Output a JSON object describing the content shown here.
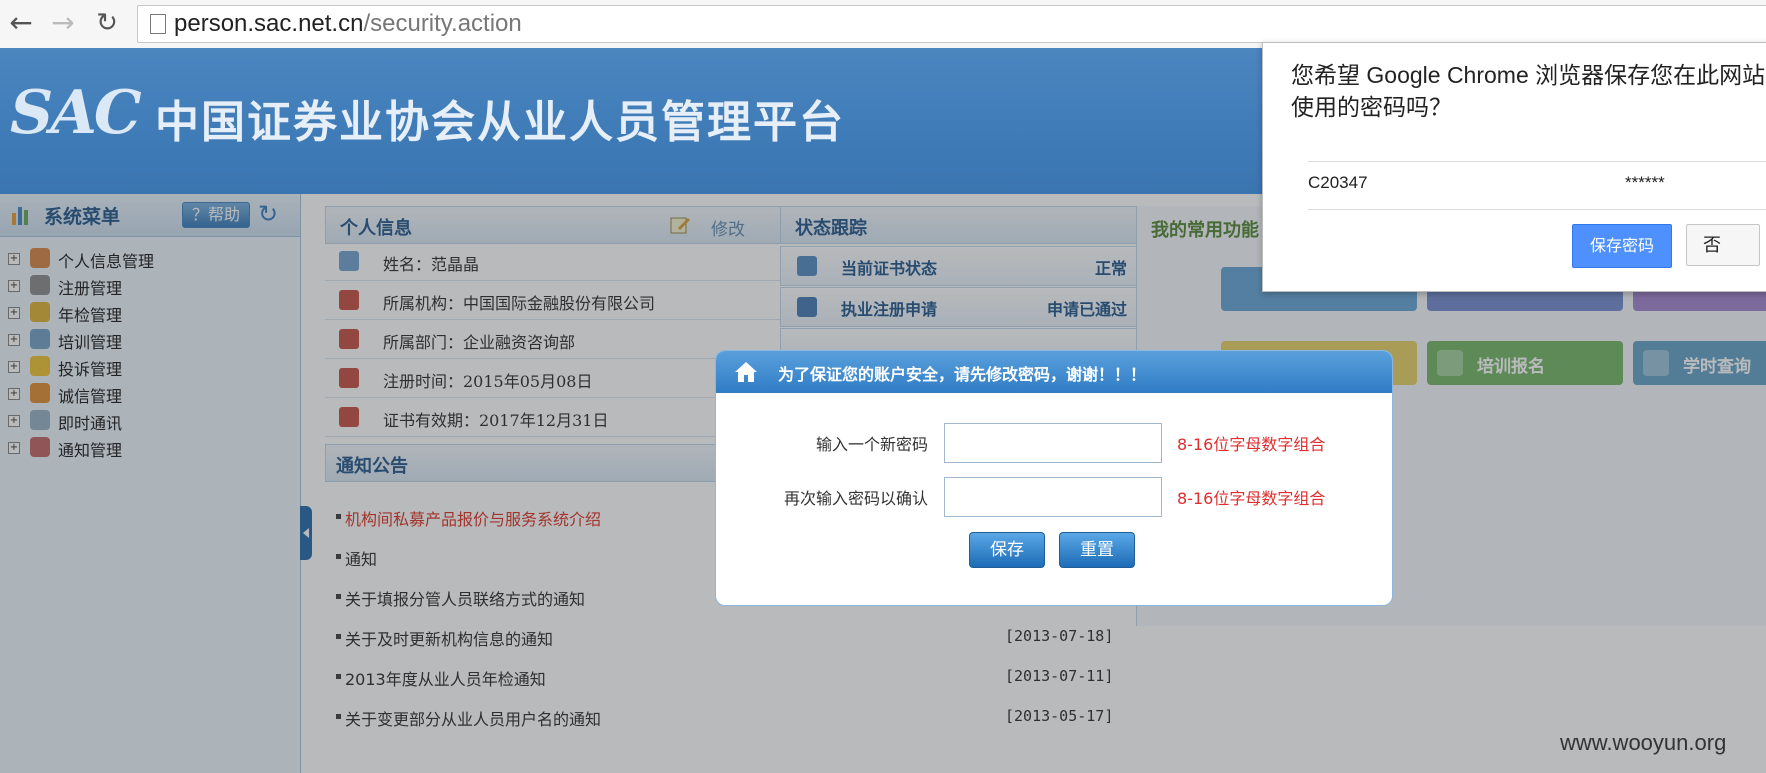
{
  "browser": {
    "url_host": "person.sac.net.cn",
    "url_path": "/security.action",
    "icons": {
      "back": "back-arrow-icon",
      "forward": "forward-arrow-icon",
      "reload": "reload-icon",
      "page": "page-icon"
    }
  },
  "site": {
    "logo_text": "SAC",
    "title": "中国证券业协会从业人员管理平台"
  },
  "sidebar": {
    "title": "系统菜单",
    "help_label": "？帮助",
    "items": [
      {
        "label": "个人信息管理",
        "color": "#d98a4a"
      },
      {
        "label": "注册管理",
        "color": "#8f8f8f"
      },
      {
        "label": "年检管理",
        "color": "#e0b53a"
      },
      {
        "label": "培训管理",
        "color": "#7aa6c9"
      },
      {
        "label": "投诉管理",
        "color": "#f0c53a"
      },
      {
        "label": "诚信管理",
        "color": "#e4923a"
      },
      {
        "label": "即时通讯",
        "color": "#9ab4c8"
      },
      {
        "label": "通知管理",
        "color": "#c46b6b"
      }
    ]
  },
  "personal_info": {
    "title": "个人信息",
    "edit_label": "修改",
    "rows": [
      "姓名：范晶晶",
      "所属机构：中国国际金融股份有限公司",
      "所属部门：企业融资咨询部",
      "注册时间：2015年05月08日",
      "证书有效期：2017年12月31日"
    ]
  },
  "status_tracking": {
    "title": "状态跟踪",
    "rows": [
      {
        "label": "当前证书状态",
        "value": "正常"
      },
      {
        "label": "执业注册申请",
        "value": "申请已通过"
      }
    ]
  },
  "notices": {
    "title": "通知公告",
    "items": [
      {
        "text": "机构间私募产品报价与服务系统介绍",
        "date": ""
      },
      {
        "text": "通知",
        "date": ""
      },
      {
        "text": "关于填报分管人员联络方式的通知",
        "date": ""
      },
      {
        "text": "关于及时更新机构信息的通知",
        "date": "[2013-07-18]"
      },
      {
        "text": "2013年度从业人员年检通知",
        "date": "[2013-07-11]"
      },
      {
        "text": "关于变更部分从业人员用户名的通知",
        "date": "[2013-05-17]"
      }
    ]
  },
  "quick_functions": {
    "title": "我的常用功能",
    "tiles": [
      {
        "label": "培训报名",
        "color": "#79b86a"
      },
      {
        "label": "学时查询",
        "color": "#6aa6c8"
      }
    ]
  },
  "modal": {
    "title": "为了保证您的账户安全，请先修改密码，谢谢！！！",
    "new_password_label": "输入一个新密码",
    "confirm_password_label": "再次输入密码以确认",
    "new_password_hint": "8-16位字母数字组合",
    "confirm_password_hint": "8-16位字母数字组合",
    "save_label": "保存",
    "reset_label": "重置"
  },
  "password_bubble": {
    "message": "您希望 Google Chrome 浏览器保存您在此网站使用的密码吗？",
    "username": "C20347",
    "password_mask": "******",
    "save_label": "保存密码",
    "no_label": "否"
  },
  "watermark": "www.wooyun.org"
}
